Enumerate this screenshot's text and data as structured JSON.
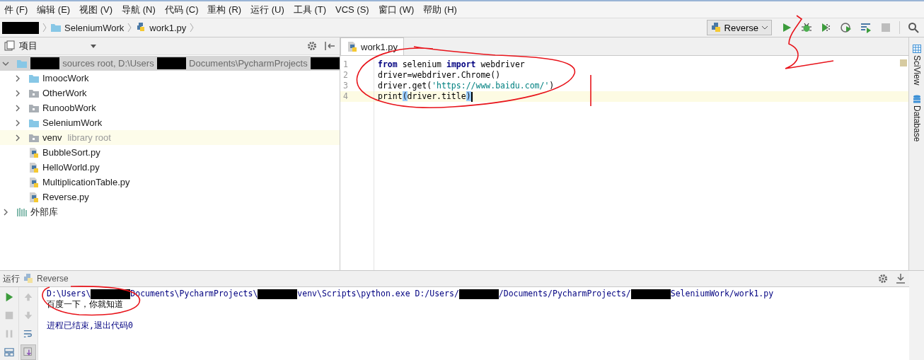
{
  "menu": [
    "件 (F)",
    "编辑 (E)",
    "视图 (V)",
    "导航 (N)",
    "代码 (C)",
    "重构 (R)",
    "运行 (U)",
    "工具 (T)",
    "VCS (S)",
    "窗口 (W)",
    "帮助 (H)"
  ],
  "breadcrumb": [
    {
      "kind": "redacted"
    },
    {
      "kind": "folder",
      "label": "SeleniumWork"
    },
    {
      "kind": "file",
      "label": "work1.py"
    }
  ],
  "run_config": {
    "label": "Reverse"
  },
  "project_panel": {
    "title": "项目",
    "root": {
      "expanded": true,
      "selected": true,
      "segments": [
        {
          "kind": "redacted"
        },
        {
          "kind": "text",
          "text": "sources root,  D:\\Users"
        },
        {
          "kind": "redacted"
        },
        {
          "kind": "text",
          "text": "Documents\\PycharmProjects"
        },
        {
          "kind": "redacted"
        }
      ]
    },
    "children": [
      {
        "kind": "source-folder",
        "label": "ImoocWork",
        "expanded": false,
        "highlighted": false
      },
      {
        "kind": "folder",
        "label": "OtherWork",
        "expanded": false,
        "highlighted": false
      },
      {
        "kind": "folder",
        "label": "RunoobWork",
        "expanded": false,
        "highlighted": false
      },
      {
        "kind": "source-folder",
        "label": "SeleniumWork",
        "expanded": false,
        "highlighted": false
      },
      {
        "kind": "folder",
        "label": "venv",
        "note": "library root",
        "expanded": false,
        "highlighted": true
      },
      {
        "kind": "file",
        "label": "BubbleSort.py",
        "highlighted": false
      },
      {
        "kind": "file",
        "label": "HelloWorld.py",
        "highlighted": false
      },
      {
        "kind": "file",
        "label": "MultiplicationTable.py",
        "highlighted": false
      },
      {
        "kind": "file",
        "label": "Reverse.py",
        "highlighted": false
      }
    ],
    "library": {
      "label": "外部库",
      "expanded": false
    }
  },
  "editor": {
    "tab": {
      "label": "work1.py",
      "selected": true
    },
    "lines": [
      {
        "number": "1",
        "current": false,
        "tokens": [
          {
            "kind": "kw",
            "text": "from"
          },
          {
            "kind": "plain",
            "text": " selenium "
          },
          {
            "kind": "kw",
            "text": "import"
          },
          {
            "kind": "plain",
            "text": " webdriver"
          }
        ]
      },
      {
        "number": "2",
        "current": false,
        "tokens": [
          {
            "kind": "plain",
            "text": "driver=webdriver.Chrome()"
          }
        ]
      },
      {
        "number": "3",
        "current": false,
        "tokens": [
          {
            "kind": "plain",
            "text": "driver.get("
          },
          {
            "kind": "str",
            "text": "'https://www.baidu.com/'"
          },
          {
            "kind": "plain",
            "text": ")"
          }
        ]
      },
      {
        "number": "4",
        "current": true,
        "tokens": [
          {
            "kind": "plain",
            "text": "print"
          },
          {
            "kind": "bracket",
            "text": "("
          },
          {
            "kind": "plain",
            "text": "driver.title"
          },
          {
            "kind": "bracket",
            "text": ")"
          }
        ]
      }
    ]
  },
  "side_tabs": [
    "SciView",
    "Database"
  ],
  "run_panel": {
    "title": "运行",
    "config": "Reverse",
    "console": [
      {
        "kind": "system",
        "segments": [
          {
            "kind": "text",
            "text": "D:\\Users\\"
          },
          {
            "kind": "redacted"
          },
          {
            "kind": "text",
            "text": "Documents\\PycharmProjects\\"
          },
          {
            "kind": "redacted"
          },
          {
            "kind": "text",
            "text": "venv\\Scripts\\python.exe D:/Users/"
          },
          {
            "kind": "redacted"
          },
          {
            "kind": "text",
            "text": "/Documents/PycharmProjects/"
          },
          {
            "kind": "redacted"
          },
          {
            "kind": "text",
            "text": "SeleniumWork/work1.py"
          }
        ]
      },
      {
        "kind": "output",
        "segments": [
          {
            "kind": "text",
            "text": "百度一下，你就知道"
          }
        ]
      },
      {
        "kind": "blank"
      },
      {
        "kind": "system",
        "segments": [
          {
            "kind": "text",
            "text": "进程已结束,退出代码0"
          }
        ]
      }
    ]
  }
}
